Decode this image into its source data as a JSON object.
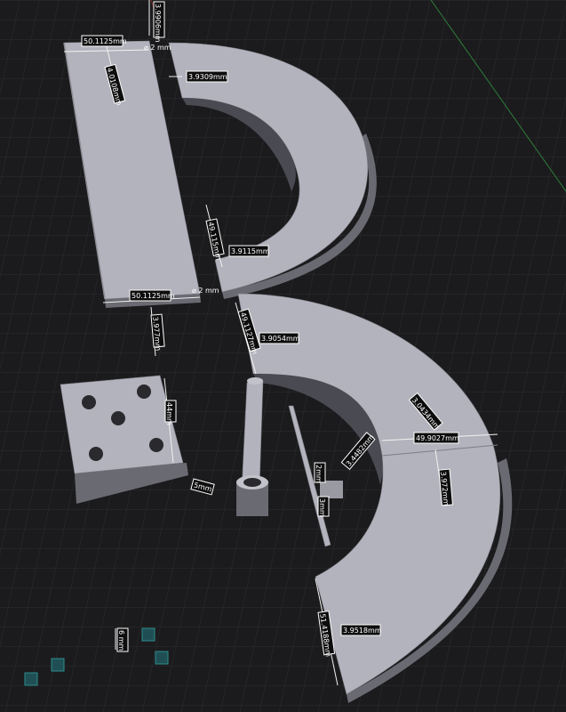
{
  "viewport": {
    "background": "#1b1b1d",
    "grid_color": "#2d2d30",
    "axis_green": "#2e7d3a",
    "part_color": "#b3b3bd"
  },
  "dimensions": {
    "d1": "3.9906mm",
    "d2": "50.1125mm",
    "d3": "⌀ 2 mm",
    "d4": "4.0108mm",
    "d5": "3.9309mm",
    "d6": "49.115mm",
    "d7": "3.9115mm",
    "d8": "50.1125mm",
    "d9": "⌀ 2 mm",
    "d10": "3.977mm",
    "d11": "49.1127mm",
    "d12": "3.9054mm",
    "d13": "44mm",
    "d14": "5mm",
    "d15": "3.0434mm",
    "d16": "49.9027mm",
    "d17": "3.4482mm",
    "d18": "3.972mm",
    "d19": "2mm",
    "d20": "3mm",
    "d21": "51.4188mm",
    "d22": "3.9518mm",
    "d23": "6 mm"
  }
}
